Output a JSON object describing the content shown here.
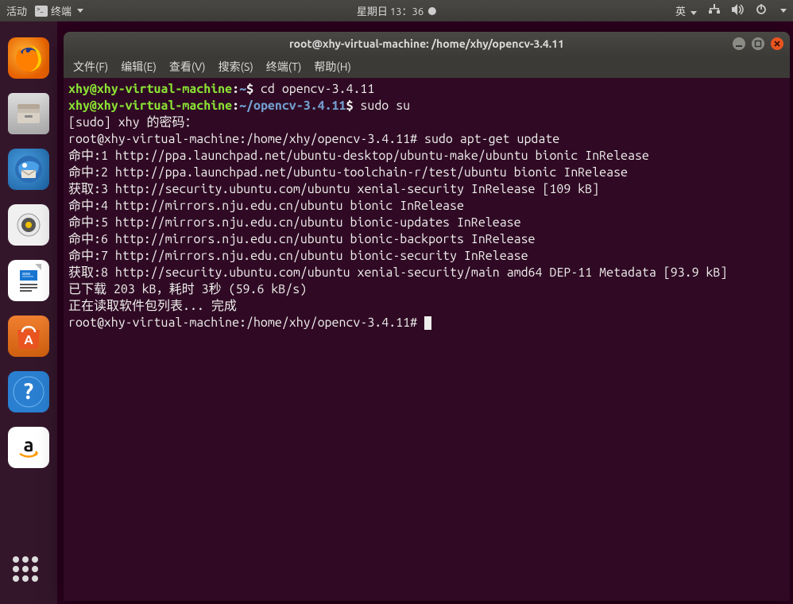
{
  "topbar": {
    "activities": "活动",
    "app_label": "终端",
    "date_time": "星期日 13：36",
    "input_method": "英"
  },
  "window": {
    "title": "root@xhy-virtual-machine: /home/xhy/opencv-3.4.11"
  },
  "menubar": {
    "file": "文件(F)",
    "edit": "编辑(E)",
    "view": "查看(V)",
    "search": "搜索(S)",
    "terminal": "终端(T)",
    "help": "帮助(H)"
  },
  "prompt1": {
    "user": "xhy@xhy-virtual-machine",
    "colon": ":",
    "path": "~",
    "sym": "$",
    "cmd": " cd opencv-3.4.11"
  },
  "prompt2": {
    "user": "xhy@xhy-virtual-machine",
    "colon": ":",
    "path": "~/opencv-3.4.11",
    "sym": "$",
    "cmd": " sudo su"
  },
  "lines": {
    "l3": "[sudo] xhy 的密码：",
    "l4": "root@xhy-virtual-machine:/home/xhy/opencv-3.4.11# sudo apt-get update",
    "l5": "命中:1 http://ppa.launchpad.net/ubuntu-desktop/ubuntu-make/ubuntu bionic InRelease",
    "l6": "命中:2 http://ppa.launchpad.net/ubuntu-toolchain-r/test/ubuntu bionic InRelease",
    "l7": "获取:3 http://security.ubuntu.com/ubuntu xenial-security InRelease [109 kB]",
    "l8": "命中:4 http://mirrors.nju.edu.cn/ubuntu bionic InRelease",
    "l9": "命中:5 http://mirrors.nju.edu.cn/ubuntu bionic-updates InRelease",
    "l10": "命中:6 http://mirrors.nju.edu.cn/ubuntu bionic-backports InRelease",
    "l11": "命中:7 http://mirrors.nju.edu.cn/ubuntu bionic-security InRelease",
    "l12": "获取:8 http://security.ubuntu.com/ubuntu xenial-security/main amd64 DEP-11 Metadata [93.9 kB]",
    "l13": "已下载 203 kB，耗时 3秒 (59.6 kB/s)",
    "l14": "正在读取软件包列表... 完成",
    "l15": "root@xhy-virtual-machine:/home/xhy/opencv-3.4.11# "
  }
}
